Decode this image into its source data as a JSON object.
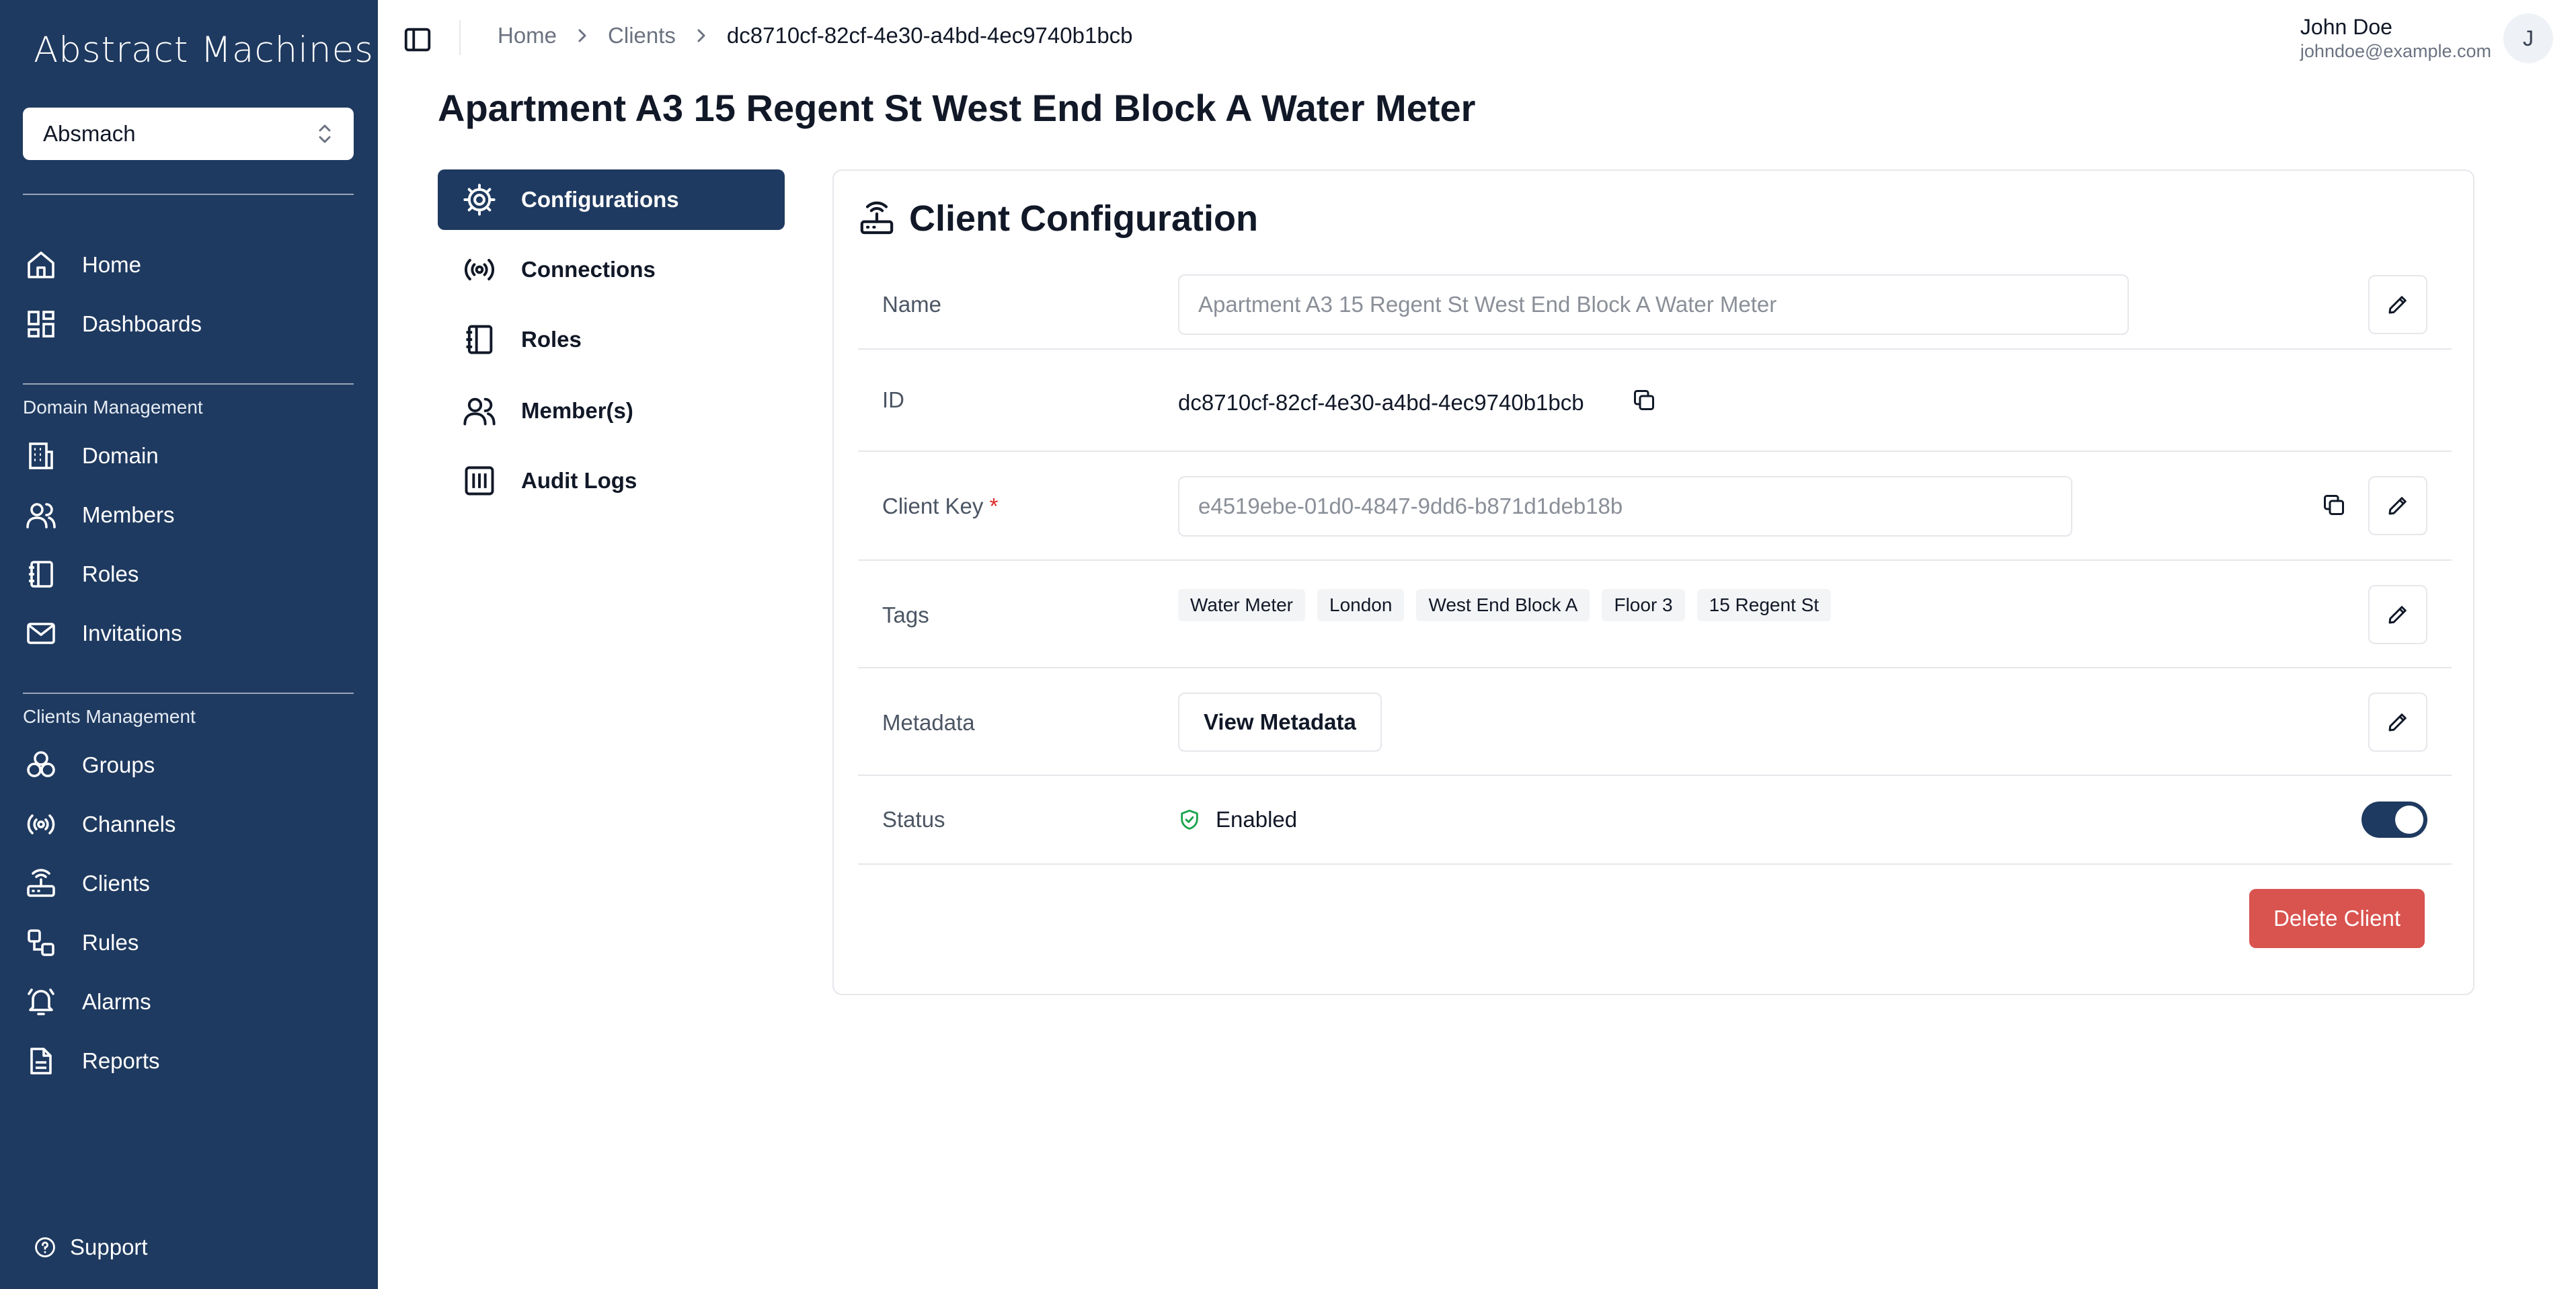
{
  "sidebar": {
    "logo": "Abstract Machines",
    "domain_select": "Absmach",
    "items_main": [
      {
        "label": "Home",
        "icon": "home-icon"
      },
      {
        "label": "Dashboards",
        "icon": "dashboard-icon"
      }
    ],
    "section_domain": "Domain Management",
    "items_domain": [
      {
        "label": "Domain",
        "icon": "building-icon"
      },
      {
        "label": "Members",
        "icon": "users-icon"
      },
      {
        "label": "Roles",
        "icon": "notebook-icon"
      },
      {
        "label": "Invitations",
        "icon": "mail-icon"
      }
    ],
    "section_clients": "Clients Management",
    "items_clients": [
      {
        "label": "Groups",
        "icon": "groups-icon"
      },
      {
        "label": "Channels",
        "icon": "broadcast-icon"
      },
      {
        "label": "Clients",
        "icon": "router-icon"
      },
      {
        "label": "Rules",
        "icon": "workflow-icon"
      },
      {
        "label": "Alarms",
        "icon": "bell-icon"
      },
      {
        "label": "Reports",
        "icon": "file-icon"
      }
    ],
    "support": "Support"
  },
  "breadcrumb": {
    "home": "Home",
    "clients": "Clients",
    "current": "dc8710cf-82cf-4e30-a4bd-4ec9740b1bcb"
  },
  "user": {
    "name": "John Doe",
    "email": "johndoe@example.com",
    "initial": "J"
  },
  "page": {
    "title": "Apartment A3 15 Regent St West End Block A Water Meter"
  },
  "subnav": [
    {
      "label": "Configurations",
      "icon": "gear-icon",
      "active": true
    },
    {
      "label": "Connections",
      "icon": "broadcast-icon",
      "active": false
    },
    {
      "label": "Roles",
      "icon": "notebook-icon",
      "active": false
    },
    {
      "label": "Member(s)",
      "icon": "users-icon",
      "active": false
    },
    {
      "label": "Audit Logs",
      "icon": "audit-icon",
      "active": false
    }
  ],
  "config": {
    "title": "Client Configuration",
    "name_label": "Name",
    "name_value": "Apartment A3 15 Regent St West End Block A Water Meter",
    "id_label": "ID",
    "id_value": "dc8710cf-82cf-4e30-a4bd-4ec9740b1bcb",
    "key_label": "Client Key",
    "key_required": "*",
    "key_value": "e4519ebe-01d0-4847-9dd6-b871d1deb18b",
    "tags_label": "Tags",
    "tags": [
      "Water Meter",
      "London",
      "West End Block A",
      "Floor 3",
      "15 Regent St"
    ],
    "metadata_label": "Metadata",
    "metadata_button": "View Metadata",
    "status_label": "Status",
    "status_value": "Enabled",
    "status_enabled": true,
    "delete_button": "Delete Client"
  },
  "colors": {
    "sidebar_bg": "#1f3a60",
    "accent": "#1f3a60",
    "danger": "#d9534f",
    "status_ok": "#16a34a"
  }
}
